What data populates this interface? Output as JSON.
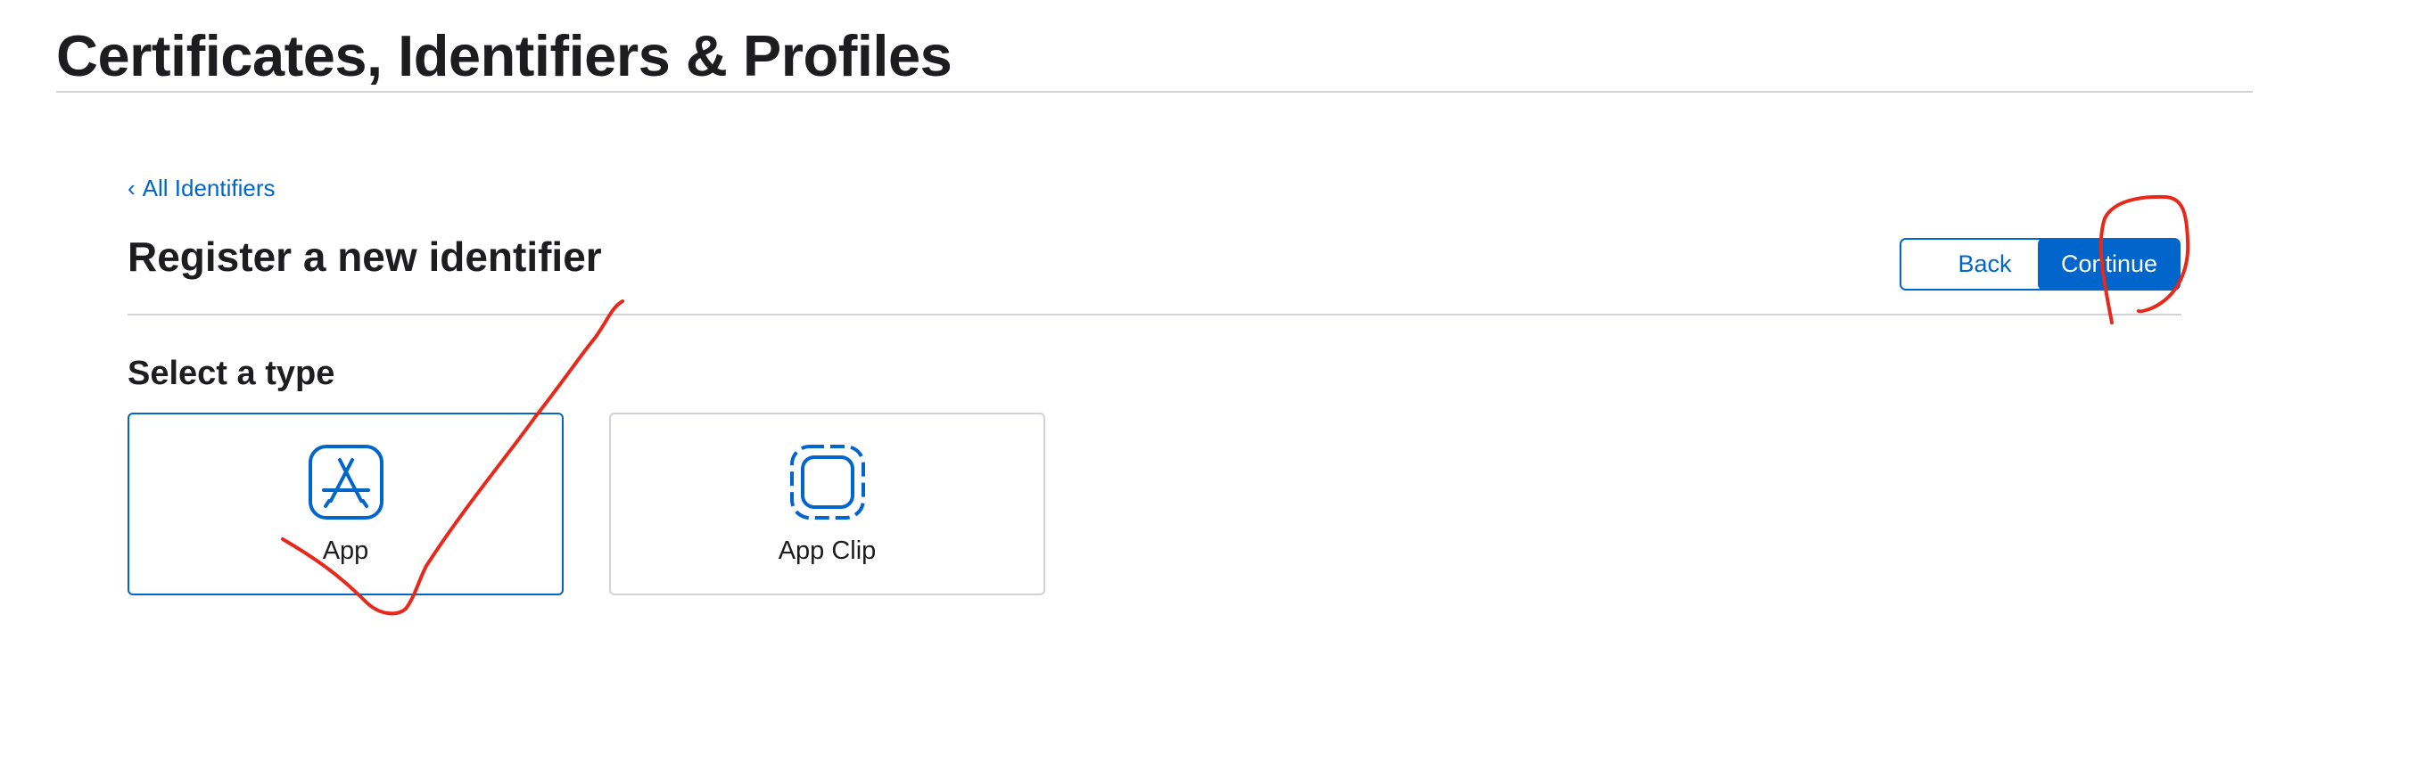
{
  "page": {
    "title": "Certificates, Identifiers & Profiles"
  },
  "breadcrumb": {
    "back_link_label": "All Identifiers"
  },
  "main": {
    "section_title": "Register a new identifier",
    "back_button_label": "Back",
    "continue_button_label": "Continue",
    "subsection_title": "Select a type",
    "type_options": [
      {
        "label": "App",
        "icon": "app-store-icon",
        "selected": true
      },
      {
        "label": "App Clip",
        "icon": "app-clip-icon",
        "selected": false
      }
    ]
  },
  "colors": {
    "accent": "#0066cc",
    "annotation": "#e8281a",
    "divider": "#d2d2d7",
    "text": "#1d1d1f"
  }
}
